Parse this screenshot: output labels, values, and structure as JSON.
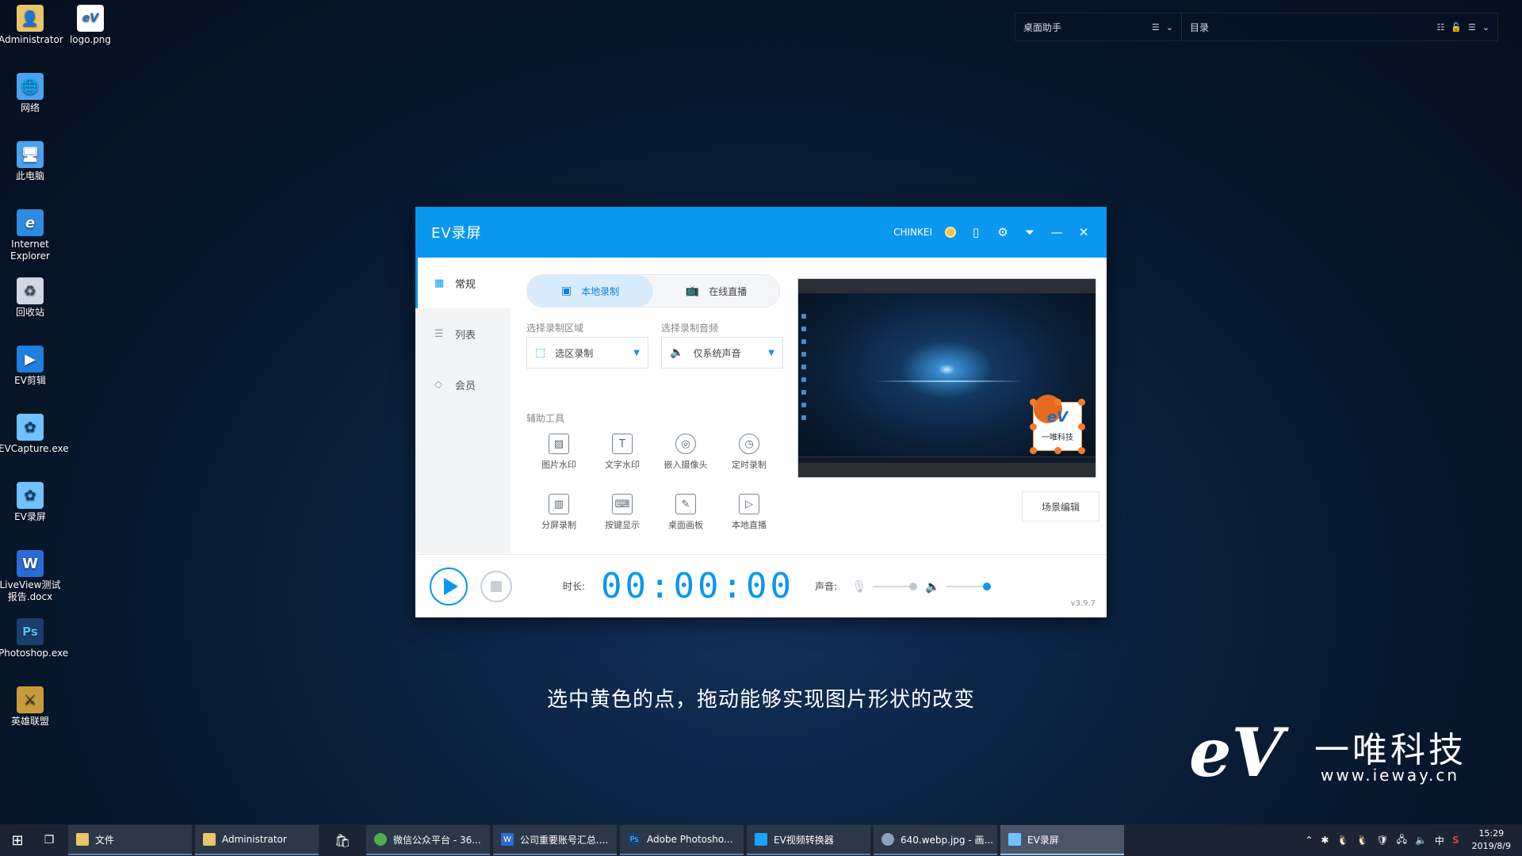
{
  "desktop_icons": [
    {
      "label": "Administrator",
      "icon": "user-folder-icon",
      "color": "#e9c46a"
    },
    {
      "label": "logo.png",
      "icon": "image-file-icon",
      "color": "#ffffff"
    },
    {
      "label": "网络",
      "icon": "network-icon",
      "color": "#4aa3f0"
    },
    {
      "label": "此电脑",
      "icon": "computer-icon",
      "color": "#4aa3f0"
    },
    {
      "label": "Internet Explorer",
      "icon": "ie-icon",
      "color": "#2d8be0"
    },
    {
      "label": "回收站",
      "icon": "recycle-bin-icon",
      "color": "#cfd8e3"
    },
    {
      "label": "EV剪辑",
      "icon": "ev-edit-icon",
      "color": "#1e7fe0"
    },
    {
      "label": "EVCapture.exe",
      "icon": "evcapture-icon",
      "color": "#6fc2ff"
    },
    {
      "label": "EV录屏",
      "icon": "ev-record-icon",
      "color": "#6fc2ff"
    },
    {
      "label": "LiveView测试报告.docx",
      "icon": "word-doc-icon",
      "color": "#2b6bd6"
    },
    {
      "label": "Photoshop.exe",
      "icon": "photoshop-icon",
      "color": "#1b3e6e"
    },
    {
      "label": "英雄联盟",
      "icon": "lol-icon",
      "color": "#c89b3c"
    }
  ],
  "topbar": {
    "left_label": "桌面助手",
    "right_label": "目录"
  },
  "ev": {
    "title": "EV录屏",
    "user": "CHINKEI",
    "sidebar": [
      {
        "label": "常规",
        "icon": "grid-icon"
      },
      {
        "label": "列表",
        "icon": "list-icon"
      },
      {
        "label": "会员",
        "icon": "diamond-icon"
      }
    ],
    "tabs": {
      "local": "本地录制",
      "live": "在线直播"
    },
    "area_label": "选择录制区域",
    "area_value": "选区录制",
    "audio_label": "选择录制音频",
    "audio_value": "仅系统声音",
    "tools_label": "辅助工具",
    "tools": [
      {
        "label": "图片水印",
        "glyph": "▨"
      },
      {
        "label": "文字水印",
        "glyph": "T"
      },
      {
        "label": "嵌入摄像头",
        "glyph": "◎"
      },
      {
        "label": "定时录制",
        "glyph": "◷"
      },
      {
        "label": "分屏录制",
        "glyph": "▥"
      },
      {
        "label": "按键显示",
        "glyph": "⌨"
      },
      {
        "label": "桌面画板",
        "glyph": "✎"
      },
      {
        "label": "本地直播",
        "glyph": "▷"
      }
    ],
    "watermark_text": "一唯科技",
    "watermark_logo": "eV",
    "scene_button": "场景编辑",
    "duration_label": "时长:",
    "timer": "00:00:00",
    "volume_label": "声音:",
    "version": "v3.9.7",
    "accent": "#0a97f0"
  },
  "subtitle": "选中黄色的点，拖动能够实现图片形状的改变",
  "brand": {
    "logo": "eV",
    "name": "一唯科技",
    "url": "www.ieway.cn"
  },
  "taskbar": {
    "items": [
      {
        "label": "文件",
        "icon": "folder-icon",
        "color": "#e9c46a",
        "active": false
      },
      {
        "label": "Administrator",
        "icon": "folder-icon",
        "color": "#e9c46a",
        "active": false
      },
      {
        "label": "微信公众平台 - 36...",
        "icon": "chrome-icon",
        "color": "#4caf50",
        "active": false
      },
      {
        "label": "公司重要账号汇总....",
        "icon": "word-doc-icon",
        "color": "#2b6bd6",
        "active": false
      },
      {
        "label": "Adobe Photosho...",
        "icon": "photoshop-icon",
        "color": "#1b3e6e",
        "active": false
      },
      {
        "label": "EV视频转换器",
        "icon": "ev-convert-icon",
        "color": "#19a3f2",
        "active": false
      },
      {
        "label": "640.webp.jpg - 画...",
        "icon": "paint-icon",
        "color": "#8aa2bf",
        "active": false
      },
      {
        "label": "EV录屏",
        "icon": "ev-record-icon",
        "color": "#6fc2ff",
        "active": true
      }
    ],
    "ime": "中",
    "time": "15:29",
    "date": "2019/8/9"
  }
}
